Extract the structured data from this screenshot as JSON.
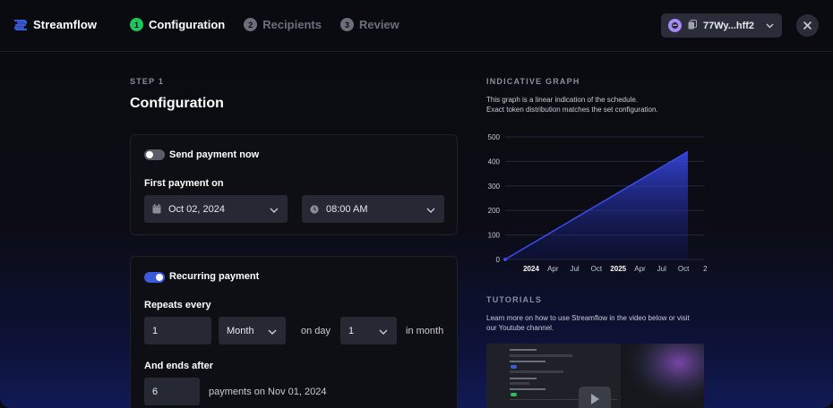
{
  "app": {
    "name": "Streamflow"
  },
  "steps": [
    {
      "num": "1",
      "label": "Configuration",
      "state": "active"
    },
    {
      "num": "2",
      "label": "Recipients",
      "state": "inactive"
    },
    {
      "num": "3",
      "label": "Review",
      "state": "inactive"
    }
  ],
  "wallet": {
    "address": "77Wy...hff2"
  },
  "config": {
    "kicker": "STEP 1",
    "title": "Configuration",
    "send_now": {
      "label": "Send payment now",
      "enabled": false
    },
    "first_payment": {
      "label": "First payment on",
      "date": "Oct 02, 2024",
      "time": "08:00 AM"
    },
    "recurring": {
      "label": "Recurring payment",
      "enabled": true,
      "repeats_label": "Repeats every",
      "interval": "1",
      "unit": "Month",
      "on_day_label": "on day",
      "day": "1",
      "in_month_label": "in month",
      "ends_label": "And ends after",
      "payments_count": "6",
      "payments_suffix": "payments on Nov 01, 2024"
    }
  },
  "graph_section": {
    "title": "INDICATIVE GRAPH",
    "desc_line1": "This graph is a linear indication of the schedule.",
    "desc_line2": "Exact token distribution matches the set configuration."
  },
  "tutorials": {
    "title": "TUTORIALS",
    "desc_line1": "Learn more on how to use Streamflow in the video below or visit",
    "desc_line2": "our Youtube channel."
  },
  "colors": {
    "accent": "#3b5bdb",
    "step_active": "#21c55d",
    "line": "#3a4cf0"
  },
  "chart_data": {
    "type": "area",
    "ylim": [
      0,
      500
    ],
    "yticks": [
      "0",
      "100",
      "200",
      "300",
      "400",
      "500"
    ],
    "xticks": [
      {
        "label": "2024",
        "bold": true
      },
      {
        "label": "Apr",
        "bold": false
      },
      {
        "label": "Jul",
        "bold": false
      },
      {
        "label": "Oct",
        "bold": false
      },
      {
        "label": "2025",
        "bold": true
      },
      {
        "label": "Apr",
        "bold": false
      },
      {
        "label": "Jul",
        "bold": false
      },
      {
        "label": "Oct",
        "bold": false
      },
      {
        "label": "2",
        "bold": false
      }
    ],
    "series": [
      {
        "values": [
          0,
          440
        ]
      }
    ],
    "grid": true
  }
}
